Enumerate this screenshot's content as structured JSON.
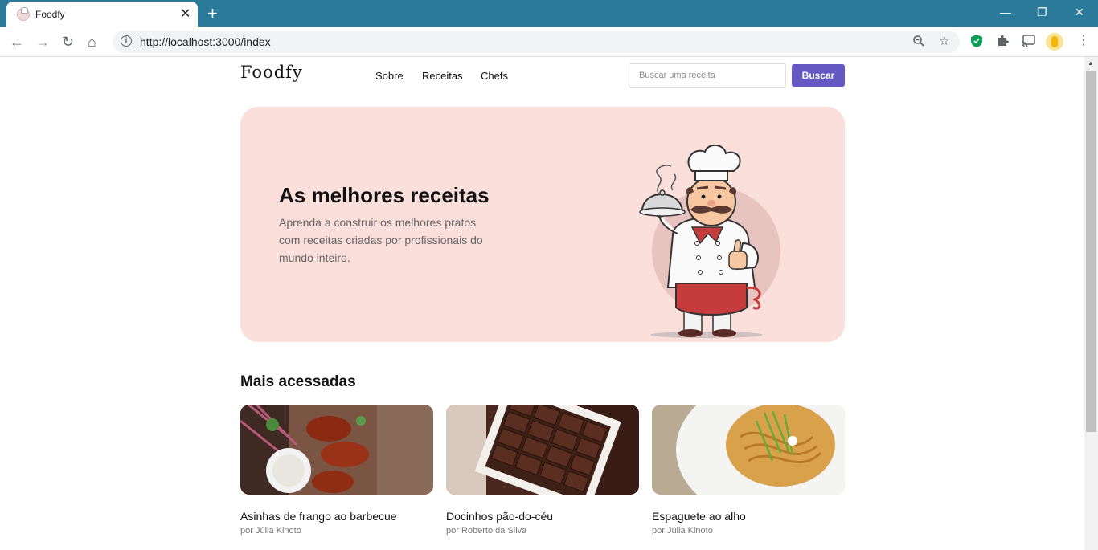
{
  "browser": {
    "tab_title": "Foodfy",
    "tab_close": "✕",
    "new_tab": "+",
    "url": "http://localhost:3000/index",
    "back": "←",
    "forward": "→",
    "reload": "↻",
    "home": "⌂",
    "minimize": "—",
    "restore": "❐",
    "close": "✕"
  },
  "header": {
    "logo": "Foodfy",
    "nav": [
      "Sobre",
      "Receitas",
      "Chefs"
    ],
    "search_placeholder": "Buscar uma receita",
    "search_button": "Buscar"
  },
  "hero": {
    "title": "As melhores receitas",
    "text": "Aprenda a construir os melhores pratos com receitas criadas por profissionais do mundo inteiro."
  },
  "section": {
    "title": "Mais acessadas"
  },
  "recipes": [
    {
      "title": "Asinhas de frango ao barbecue",
      "author": "por Júlia Kinoto"
    },
    {
      "title": "Docinhos pão-do-céu",
      "author": "por Roberto da Silva"
    },
    {
      "title": "Espaguete ao alho",
      "author": "por Júlia Kinoto"
    }
  ],
  "colors": {
    "tabbar": "#2c7a99",
    "accent": "#6558c3",
    "hero_bg": "#fadfdb"
  }
}
